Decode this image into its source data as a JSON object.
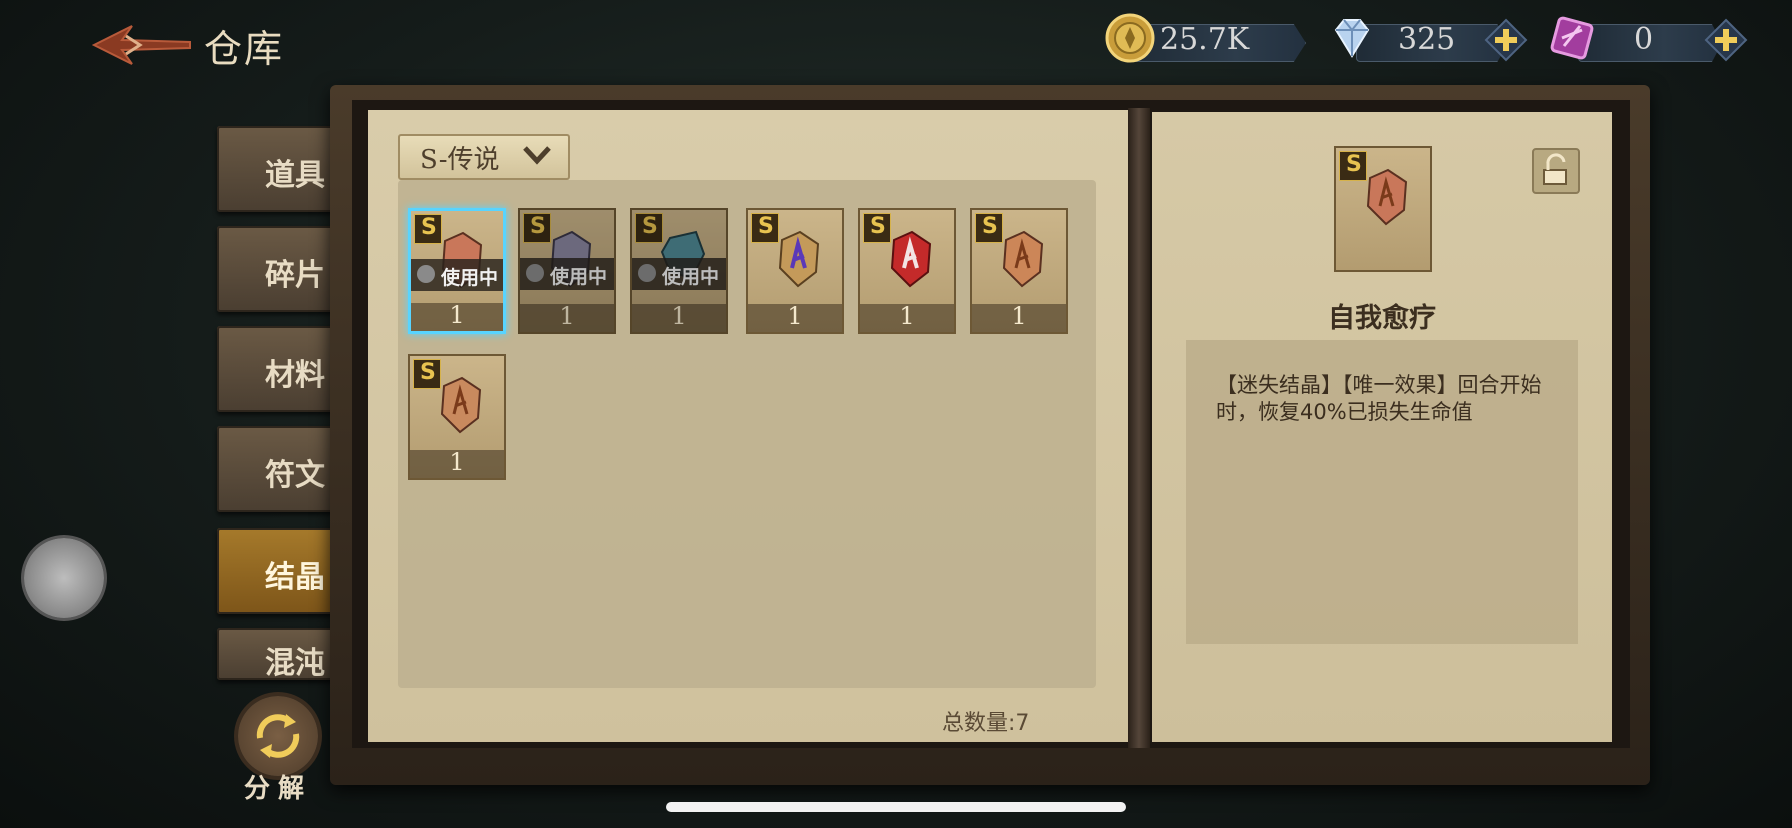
{
  "header": {
    "title": "仓库",
    "currencies": [
      {
        "name": "coin-icon",
        "value": "25.7K",
        "color": "#d4b24a",
        "addable": false
      },
      {
        "name": "diamond-icon",
        "value": "325",
        "color": "#a9c7e8",
        "addable": true
      },
      {
        "name": "purple-crystal-icon",
        "value": "0",
        "color": "#b048b0",
        "addable": true
      }
    ]
  },
  "sidebar": {
    "tabs": [
      {
        "label": "道具",
        "active": false
      },
      {
        "label": "碎片",
        "active": false
      },
      {
        "label": "材料",
        "active": false
      },
      {
        "label": "符文",
        "active": false
      },
      {
        "label": "结晶",
        "active": true
      },
      {
        "label": "混沌",
        "active": false
      }
    ],
    "decompose_label": "分解"
  },
  "inventory": {
    "filter_label": "S-传说",
    "total_label": "总数量:7",
    "rank_letter": "S",
    "in_use_label": "使用中",
    "items": [
      {
        "qty": "1",
        "in_use": true,
        "selected": true,
        "gem_color": "#c9775a"
      },
      {
        "qty": "1",
        "in_use": true,
        "selected": false,
        "gem_color": "#8b86a0"
      },
      {
        "qty": "1",
        "in_use": true,
        "selected": false,
        "gem_color": "#4f8a96"
      },
      {
        "qty": "1",
        "in_use": false,
        "selected": false,
        "gem_color": "#c49a5a",
        "rune_color": "#5a38b8"
      },
      {
        "qty": "1",
        "in_use": false,
        "selected": false,
        "gem_color": "#c42a2a"
      },
      {
        "qty": "1",
        "in_use": false,
        "selected": false,
        "gem_color": "#cc8658"
      },
      {
        "qty": "1",
        "in_use": false,
        "selected": false,
        "gem_color": "#c98a5e"
      }
    ]
  },
  "detail": {
    "name": "自我愈疗",
    "rank_letter": "S",
    "description": "【迷失结晶】【唯一效果】回合开始时，恢复40%已损失生命值"
  }
}
